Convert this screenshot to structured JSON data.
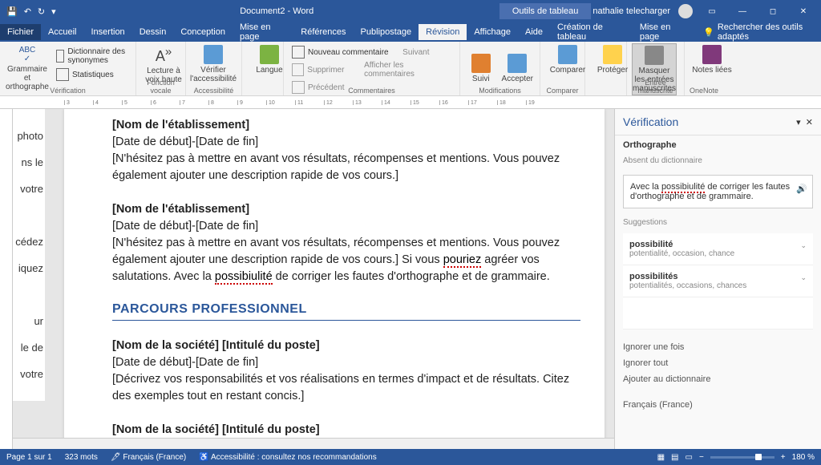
{
  "title": {
    "doc": "Document2 - Word",
    "tabletools": "Outils de tableau",
    "user": "nathalie telecharger"
  },
  "qat": {
    "save": "💾",
    "undo": "↶",
    "redo": "↷"
  },
  "menu": {
    "file": "Fichier",
    "home": "Accueil",
    "insert": "Insertion",
    "design": "Dessin",
    "layout": "Conception",
    "pagelayout": "Mise en page",
    "references": "Références",
    "mailings": "Publipostage",
    "review": "Révision",
    "view": "Affichage",
    "help": "Aide",
    "tablecreate": "Création de tableau",
    "tablelayout": "Mise en page",
    "search_ph": "Rechercher des outils adaptés"
  },
  "ribbon": {
    "g1": {
      "btn": "Grammaire et orthographe",
      "syn": "Dictionnaire des synonymes",
      "stats": "Statistiques",
      "label": "Vérification"
    },
    "g2": {
      "btn": "Lecture à voix haute",
      "label": "Fonction vocale"
    },
    "g3": {
      "btn": "Vérifier l'accessibilité",
      "label": "Accessibilité"
    },
    "g4": {
      "btn": "Langue"
    },
    "g5": {
      "new": "Nouveau commentaire",
      "del": "Supprimer",
      "prev": "Précédent",
      "next": "Suivant",
      "show": "Afficher les commentaires",
      "label": "Commentaires"
    },
    "g6": {
      "track": "Suivi",
      "accept": "Accepter",
      "label": "Modifications"
    },
    "g7": {
      "btn": "Comparer",
      "label": "Comparer"
    },
    "g8": {
      "btn": "Protéger"
    },
    "g9": {
      "btn": "Masquer les entrées manuscrites",
      "label": "Entrée manuscrite"
    },
    "g10": {
      "btn": "Notes liées",
      "label": "OneNote"
    }
  },
  "doc": {
    "frag": [
      "photo",
      "ns le",
      "votre",
      "cédez",
      "iquez",
      "ur",
      "le de",
      "votre"
    ],
    "est1_title": "[Nom de l'établissement]",
    "est1_date": "[Date de début]-[Date de fin]",
    "est1_body": "[N'hésitez pas à mettre en avant vos résultats, récompenses et mentions. Vous pouvez également ajouter une description rapide de vos cours.]",
    "est2_title": "[Nom de l'établissement]",
    "est2_date": "[Date de début]-[Date de fin]",
    "est2_body_a": "[N'hésitez pas à mettre en avant vos résultats, récompenses et mentions. Vous pouvez également ajouter une description rapide de vos cours.] Si vous ",
    "est2_err1": "pouriez",
    "est2_body_b": " agréer vos salutations. Avec la ",
    "est2_err2": "possibiulité",
    "est2_body_c": " de corriger les fautes d'orthographe et de grammaire.",
    "section": "PARCOURS PROFESSIONNEL",
    "co1_title": "[Nom de la société] [Intitulé du poste]",
    "co1_date": "[Date de début]-[Date de fin]",
    "co1_body": "[Décrivez vos responsabilités et vos réalisations en termes d'impact et de résultats. Citez des exemples tout en restant concis.]",
    "co2_title": "[Nom de la société] [Intitulé du poste]",
    "co2_date": "[Date de début]-[Date de fin]"
  },
  "pane": {
    "title": "Vérification",
    "sub": "Orthographe",
    "note": "Absent du dictionnaire",
    "sentence_a": "Avec la ",
    "sentence_err": "possibiulité",
    "sentence_b": " de corriger les fautes d'orthographe et de grammaire.",
    "sugg_label": "Suggestions",
    "s1": {
      "word": "possibilité",
      "syn": "potentialité, occasion, chance"
    },
    "s2": {
      "word": "possibilités",
      "syn": "potentialités, occasions, chances"
    },
    "act1": "Ignorer une fois",
    "act2": "Ignorer tout",
    "act3": "Ajouter au dictionnaire",
    "lang": "Français (France)"
  },
  "status": {
    "page": "Page 1 sur 1",
    "words": "323 mots",
    "lang": "Français (France)",
    "access": "Accessibilité : consultez nos recommandations",
    "zoom": "180 %"
  }
}
